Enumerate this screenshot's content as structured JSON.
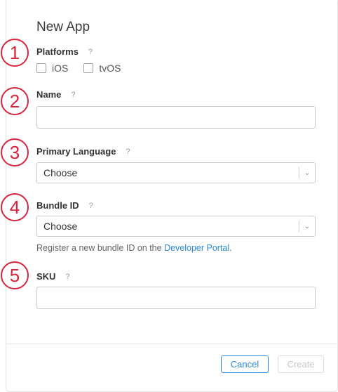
{
  "dialog": {
    "title": "New App"
  },
  "badges": [
    "1",
    "2",
    "3",
    "4",
    "5"
  ],
  "help_glyph": "?",
  "platforms": {
    "label": "Platforms",
    "options": [
      "iOS",
      "tvOS"
    ]
  },
  "name": {
    "label": "Name",
    "value": ""
  },
  "primary_language": {
    "label": "Primary Language",
    "selected": "Choose"
  },
  "bundle_id": {
    "label": "Bundle ID",
    "selected": "Choose",
    "help_prefix": "Register a new bundle ID on the ",
    "help_link": "Developer Portal",
    "help_suffix": "."
  },
  "sku": {
    "label": "SKU",
    "value": ""
  },
  "footer": {
    "cancel_label": "Cancel",
    "create_label": "Create"
  },
  "colors": {
    "accent": "#2a8ae0",
    "badge": "#d8243c",
    "disabled": "#c8c8c8"
  }
}
